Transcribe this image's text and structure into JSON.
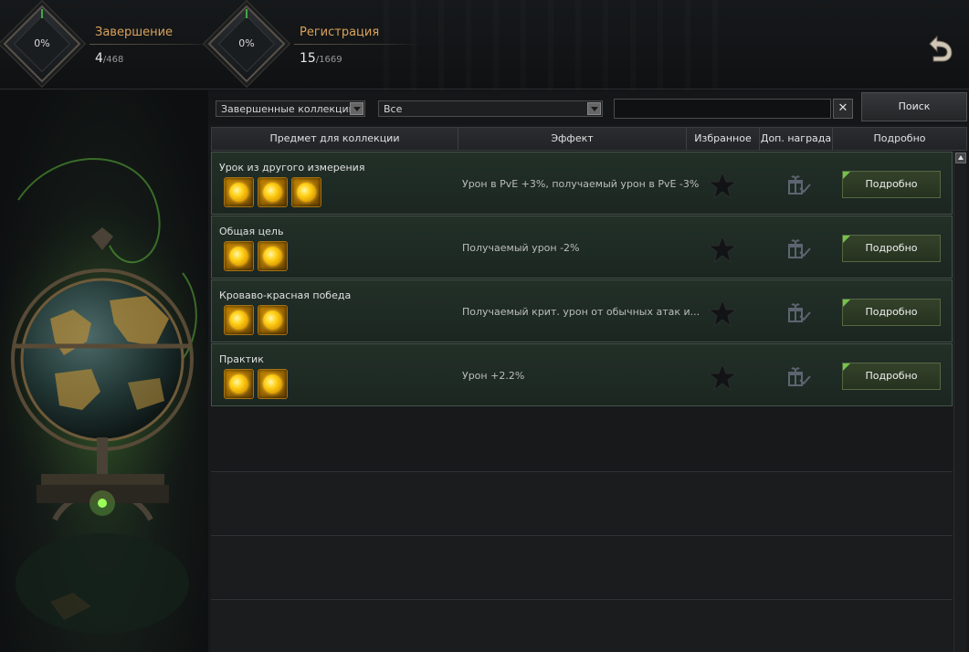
{
  "header": {
    "completion": {
      "percent": "0%",
      "label": "Завершение",
      "value": "4",
      "total": "/468"
    },
    "registration": {
      "percent": "0%",
      "label": "Регистрация",
      "value": "15",
      "total": "/1669"
    }
  },
  "filters": {
    "category": "Завершенные коллекции",
    "type": "Все",
    "search_value": "",
    "clear_label": "✕",
    "search_button": "Поиск"
  },
  "table": {
    "headers": [
      "Предмет для коллекции",
      "Эффект",
      "Избранное",
      "Доп. награда",
      "Подробно"
    ],
    "rows": [
      {
        "name": "Урок из другого измерения",
        "effect": "Урон в PvE +3%, получаемый урон в PvE -3%",
        "item_count": 3,
        "button": "Подробно"
      },
      {
        "name": "Общая цель",
        "effect": "Получаемый урон -2%",
        "item_count": 2,
        "button": "Подробно"
      },
      {
        "name": "Кроваво-красная победа",
        "effect": "Получаемый крит. урон от обычных атак и...",
        "item_count": 2,
        "button": "Подробно"
      },
      {
        "name": "Практик",
        "effect": "Урон +2.2%",
        "item_count": 2,
        "button": "Подробно"
      }
    ]
  },
  "colors": {
    "accent_orange": "#d9a25a",
    "row_green": "#223027",
    "button_green": "#34422a",
    "gold_coin": "#ffd21a"
  },
  "icons": {
    "back": "undo-arrow-icon",
    "favorite": "star-icon",
    "reward": "gift-check-icon",
    "item": "gold-orb-icon",
    "art": "globe-illustration"
  }
}
